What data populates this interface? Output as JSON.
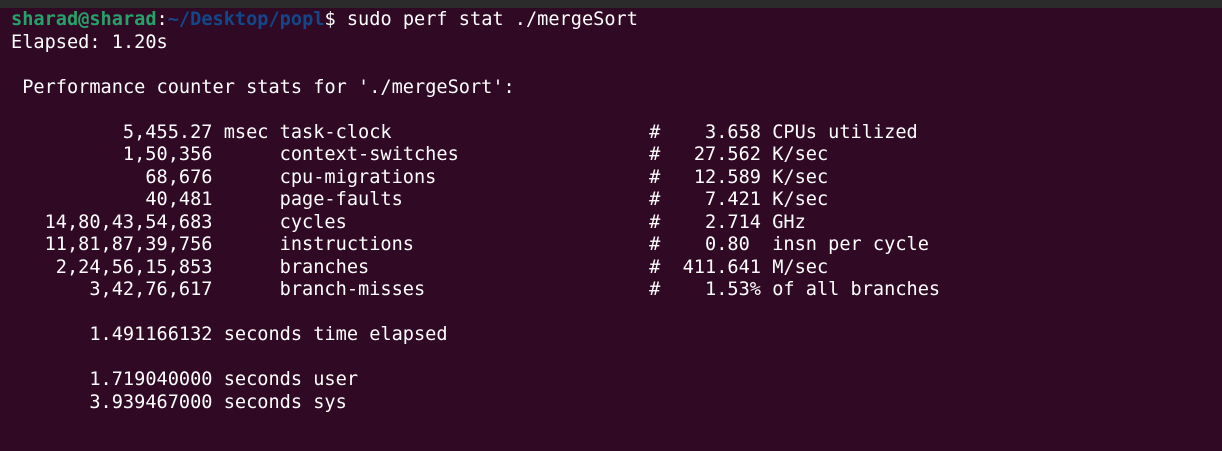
{
  "prompt": {
    "user_host": "sharad@sharad",
    "sep": ":",
    "path": "~/Desktop/popl",
    "symbol": "$",
    "command": " sudo perf stat ./mergeSort"
  },
  "elapsed_line": "Elapsed: 1.20s",
  "header": " Performance counter stats for './mergeSort':",
  "rows": [
    {
      "value": "5,455.27",
      "unit": "msec",
      "event": "task-clock",
      "metric": "3.658",
      "metric_unit": "CPUs utilized"
    },
    {
      "value": "1,50,356",
      "unit": "",
      "event": "context-switches",
      "metric": "27.562",
      "metric_unit": "K/sec"
    },
    {
      "value": "68,676",
      "unit": "",
      "event": "cpu-migrations",
      "metric": "12.589",
      "metric_unit": "K/sec"
    },
    {
      "value": "40,481",
      "unit": "",
      "event": "page-faults",
      "metric": "7.421",
      "metric_unit": "K/sec"
    },
    {
      "value": "14,80,43,54,683",
      "unit": "",
      "event": "cycles",
      "metric": "2.714",
      "metric_unit": "GHz"
    },
    {
      "value": "11,81,87,39,756",
      "unit": "",
      "event": "instructions",
      "metric": "0.80 ",
      "metric_unit": "insn per cycle"
    },
    {
      "value": "2,24,56,15,853",
      "unit": "",
      "event": "branches",
      "metric": "411.641",
      "metric_unit": "M/sec"
    },
    {
      "value": "3,42,76,617",
      "unit": "",
      "event": "branch-misses",
      "metric": "1.53%",
      "metric_unit": "of all branches"
    }
  ],
  "hash": "#",
  "times": [
    {
      "value": "1.491166132",
      "label": "seconds time elapsed"
    },
    {
      "value": "1.719040000",
      "label": "seconds user"
    },
    {
      "value": "3.939467000",
      "label": "seconds sys"
    }
  ]
}
